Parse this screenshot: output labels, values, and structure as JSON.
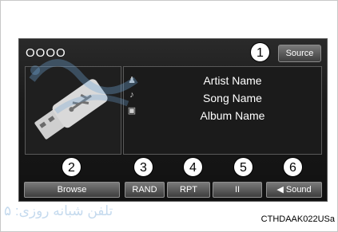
{
  "header": {
    "dots": "OOOO",
    "source_label": "Source"
  },
  "track": {
    "artist": "Artist Name",
    "song": "Song Name",
    "album": "Album Name"
  },
  "buttons": {
    "browse": "Browse",
    "rand": "RAND",
    "rpt": "RPT",
    "pause": "II",
    "sound": "Sound"
  },
  "callouts": [
    "1",
    "2",
    "3",
    "4",
    "5",
    "6"
  ],
  "caption": "CTHDAAK022USa",
  "watermark_phone_label": "تلفن شبانه روزی: ۵"
}
